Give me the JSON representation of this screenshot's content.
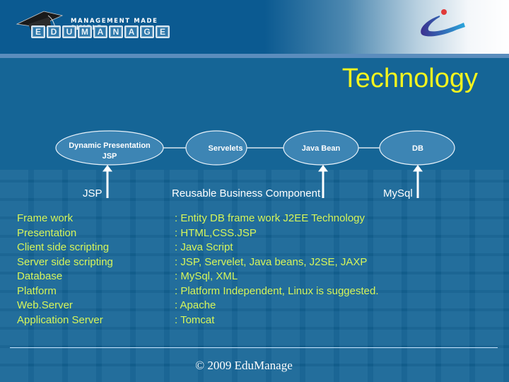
{
  "header": {
    "logo": {
      "tagline": "MANAGEMENT MADE SIMPLE",
      "letters": [
        "E",
        "D",
        "U",
        "M",
        "A",
        "N",
        "A",
        "G",
        "E"
      ],
      "icon": "graduation-cap-icon"
    },
    "brand_mark_icon": "swoosh-logo-icon"
  },
  "slide": {
    "title": "Technology",
    "title_color": "#f4f41e",
    "text_color": "#d6f55a"
  },
  "diagram": {
    "nodes": [
      {
        "line1": "Dynamic Presentation",
        "line2": "JSP"
      },
      {
        "line1": "Servelets",
        "line2": ""
      },
      {
        "line1": "Java Bean",
        "line2": ""
      },
      {
        "line1": "DB",
        "line2": ""
      }
    ],
    "labels": [
      "JSP",
      "Reusable Business Component",
      "MySql"
    ]
  },
  "specs": [
    {
      "key": "Frame work",
      "value": ": Entity DB frame work J2EE Technology"
    },
    {
      "key": "Presentation",
      "value": ": HTML,CSS.JSP"
    },
    {
      "key": "Client side scripting",
      "value": ": Java Script"
    },
    {
      "key": "Server side scripting",
      "value": ": JSP, Servelet, Java beans, J2SE,  JAXP"
    },
    {
      "key": "Database",
      "value": ": MySql, XML"
    },
    {
      "key": "Platform",
      "value": ": Platform Independent, Linux is suggested."
    },
    {
      "key": "Web.Server",
      "value": ": Apache"
    },
    {
      "key": "Application Server",
      "value": ": Tomcat"
    }
  ],
  "footer": {
    "copyright": "© 2009 EduManage"
  }
}
